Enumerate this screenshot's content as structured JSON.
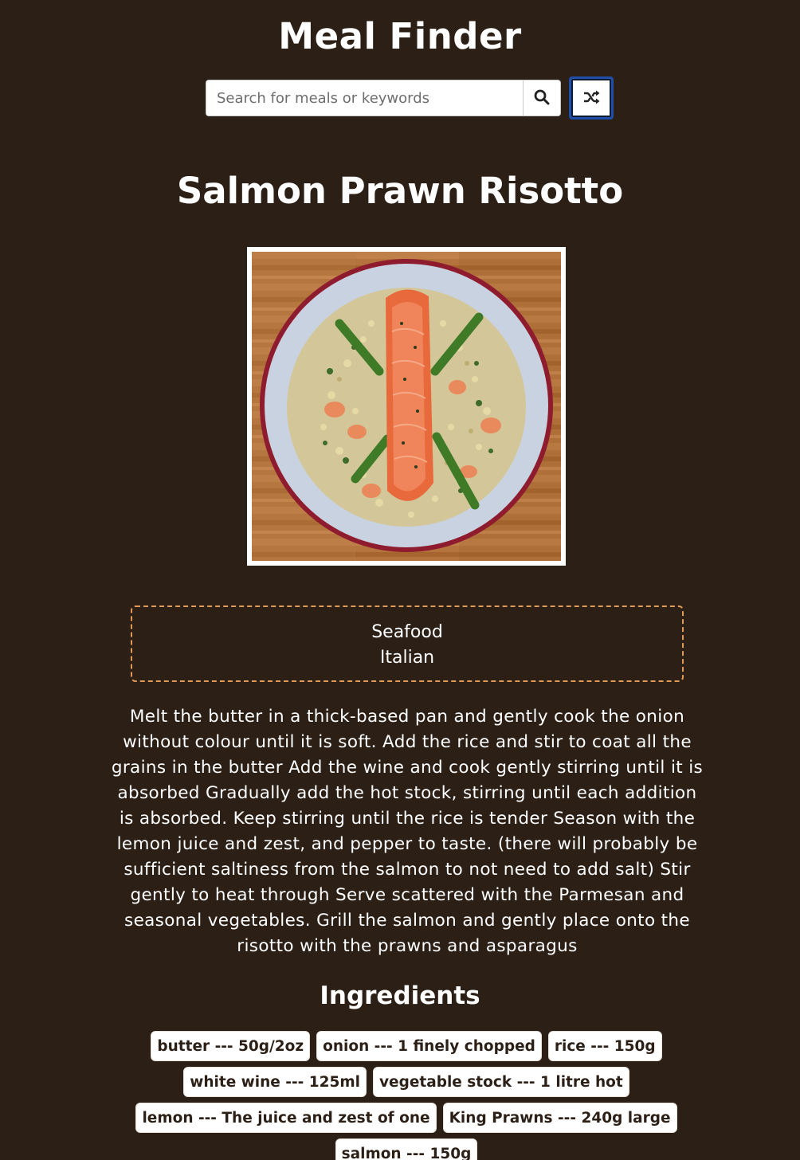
{
  "header": {
    "app_title": "Meal Finder"
  },
  "search": {
    "placeholder": "Search for meals or keywords",
    "value": "",
    "search_icon": "search-icon",
    "random_icon": "shuffle-icon"
  },
  "meal": {
    "title": "Salmon Prawn Risotto",
    "categories": [
      "Seafood",
      "Italian"
    ],
    "instructions": "Melt the butter in a thick-based pan and gently cook the onion without colour until it is soft. Add the rice and stir to coat all the grains in the butter Add the wine and cook gently stirring until it is absorbed Gradually add the hot stock, stirring until each addition is absorbed. Keep stirring until the rice is tender Season with the lemon juice and zest, and pepper to taste. (there will probably be sufficient saltiness from the salmon to not need to add salt) Stir gently to heat through Serve scattered with the Parmesan and seasonal vegetables. Grill the salmon and gently place onto the risotto with the prawns and asparagus"
  },
  "ingredients": {
    "heading": "Ingredients",
    "items": [
      "butter --- 50g/2oz",
      "onion --- 1 finely chopped",
      "rice --- 150g",
      "white wine --- 125ml",
      "vegetable stock --- 1 litre hot",
      "lemon --- The juice and zest of one",
      "King Prawns --- 240g large",
      "salmon --- 150g"
    ]
  },
  "colors": {
    "background": "#2c1f16",
    "text": "#ffffff",
    "category_border": "#e19a55",
    "random_button_border": "#1f4fa8"
  }
}
